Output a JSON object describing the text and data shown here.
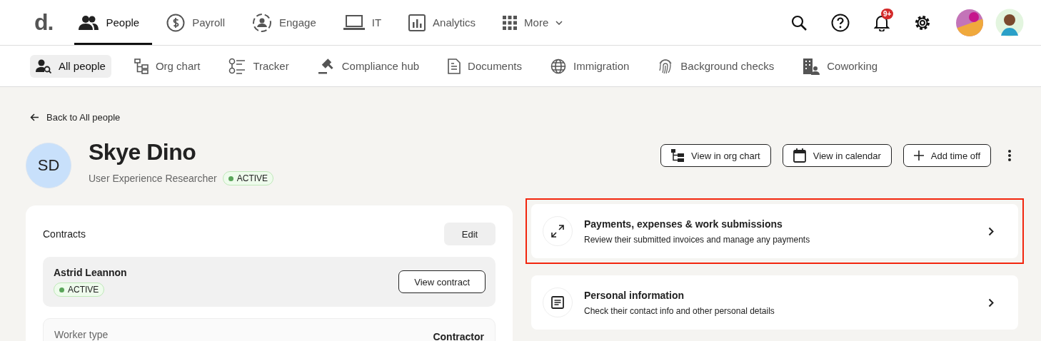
{
  "top_nav": {
    "logo": "d.",
    "items": [
      {
        "label": "People",
        "selected": true
      },
      {
        "label": "Payroll",
        "selected": false
      },
      {
        "label": "Engage",
        "selected": false
      },
      {
        "label": "IT",
        "selected": false
      },
      {
        "label": "Analytics",
        "selected": false
      },
      {
        "label": "More",
        "selected": false
      }
    ],
    "notification_badge": "9+"
  },
  "sub_nav": {
    "items": [
      {
        "label": "All people",
        "selected": true
      },
      {
        "label": "Org chart",
        "selected": false
      },
      {
        "label": "Tracker",
        "selected": false
      },
      {
        "label": "Compliance hub",
        "selected": false
      },
      {
        "label": "Documents",
        "selected": false
      },
      {
        "label": "Immigration",
        "selected": false
      },
      {
        "label": "Background checks",
        "selected": false
      },
      {
        "label": "Coworking",
        "selected": false
      }
    ]
  },
  "back_link": "Back to All people",
  "profile": {
    "initials": "SD",
    "name": "Skye Dino",
    "job_title": "User Experience Researcher",
    "status": "ACTIVE",
    "actions": [
      "View in org chart",
      "View in calendar",
      "Add time off"
    ]
  },
  "contracts": {
    "title": "Contracts",
    "edit": "Edit",
    "contract": {
      "name": "Astrid Leannon",
      "status": "ACTIVE",
      "button": "View contract"
    },
    "fields": [
      {
        "label": "Worker type",
        "value": "Contractor"
      }
    ]
  },
  "cards": [
    {
      "title": "Payments, expenses & work submissions",
      "description": "Review their submitted invoices and manage any payments",
      "highlighted": true
    },
    {
      "title": "Personal information",
      "description": "Check their contact info and other personal details",
      "highlighted": false
    }
  ]
}
